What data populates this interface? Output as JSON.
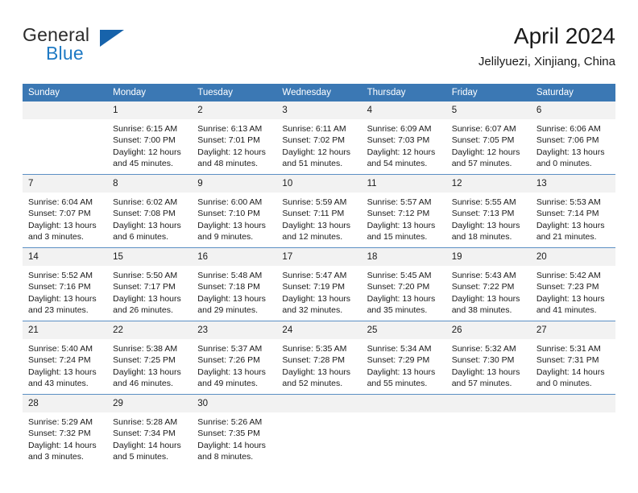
{
  "brand": {
    "name_top": "General",
    "name_bottom": "Blue",
    "triangle_color": "#1763ab",
    "blue_color": "#1f7ac4"
  },
  "header": {
    "month_title": "April 2024",
    "location": "Jelilyuezi, Xinjiang, China",
    "accent_color": "#3b78b4"
  },
  "weekday_headers": [
    "Sunday",
    "Monday",
    "Tuesday",
    "Wednesday",
    "Thursday",
    "Friday",
    "Saturday"
  ],
  "labels": {
    "sunrise": "Sunrise:",
    "sunset": "Sunset:",
    "daylight": "Daylight:"
  },
  "weeks": [
    [
      {
        "day": "",
        "sunrise": "",
        "sunset": "",
        "daylight_line1": "",
        "daylight_line2": ""
      },
      {
        "day": "1",
        "sunrise": "Sunrise: 6:15 AM",
        "sunset": "Sunset: 7:00 PM",
        "daylight_line1": "Daylight: 12 hours",
        "daylight_line2": "and 45 minutes."
      },
      {
        "day": "2",
        "sunrise": "Sunrise: 6:13 AM",
        "sunset": "Sunset: 7:01 PM",
        "daylight_line1": "Daylight: 12 hours",
        "daylight_line2": "and 48 minutes."
      },
      {
        "day": "3",
        "sunrise": "Sunrise: 6:11 AM",
        "sunset": "Sunset: 7:02 PM",
        "daylight_line1": "Daylight: 12 hours",
        "daylight_line2": "and 51 minutes."
      },
      {
        "day": "4",
        "sunrise": "Sunrise: 6:09 AM",
        "sunset": "Sunset: 7:03 PM",
        "daylight_line1": "Daylight: 12 hours",
        "daylight_line2": "and 54 minutes."
      },
      {
        "day": "5",
        "sunrise": "Sunrise: 6:07 AM",
        "sunset": "Sunset: 7:05 PM",
        "daylight_line1": "Daylight: 12 hours",
        "daylight_line2": "and 57 minutes."
      },
      {
        "day": "6",
        "sunrise": "Sunrise: 6:06 AM",
        "sunset": "Sunset: 7:06 PM",
        "daylight_line1": "Daylight: 13 hours",
        "daylight_line2": "and 0 minutes."
      }
    ],
    [
      {
        "day": "7",
        "sunrise": "Sunrise: 6:04 AM",
        "sunset": "Sunset: 7:07 PM",
        "daylight_line1": "Daylight: 13 hours",
        "daylight_line2": "and 3 minutes."
      },
      {
        "day": "8",
        "sunrise": "Sunrise: 6:02 AM",
        "sunset": "Sunset: 7:08 PM",
        "daylight_line1": "Daylight: 13 hours",
        "daylight_line2": "and 6 minutes."
      },
      {
        "day": "9",
        "sunrise": "Sunrise: 6:00 AM",
        "sunset": "Sunset: 7:10 PM",
        "daylight_line1": "Daylight: 13 hours",
        "daylight_line2": "and 9 minutes."
      },
      {
        "day": "10",
        "sunrise": "Sunrise: 5:59 AM",
        "sunset": "Sunset: 7:11 PM",
        "daylight_line1": "Daylight: 13 hours",
        "daylight_line2": "and 12 minutes."
      },
      {
        "day": "11",
        "sunrise": "Sunrise: 5:57 AM",
        "sunset": "Sunset: 7:12 PM",
        "daylight_line1": "Daylight: 13 hours",
        "daylight_line2": "and 15 minutes."
      },
      {
        "day": "12",
        "sunrise": "Sunrise: 5:55 AM",
        "sunset": "Sunset: 7:13 PM",
        "daylight_line1": "Daylight: 13 hours",
        "daylight_line2": "and 18 minutes."
      },
      {
        "day": "13",
        "sunrise": "Sunrise: 5:53 AM",
        "sunset": "Sunset: 7:14 PM",
        "daylight_line1": "Daylight: 13 hours",
        "daylight_line2": "and 21 minutes."
      }
    ],
    [
      {
        "day": "14",
        "sunrise": "Sunrise: 5:52 AM",
        "sunset": "Sunset: 7:16 PM",
        "daylight_line1": "Daylight: 13 hours",
        "daylight_line2": "and 23 minutes."
      },
      {
        "day": "15",
        "sunrise": "Sunrise: 5:50 AM",
        "sunset": "Sunset: 7:17 PM",
        "daylight_line1": "Daylight: 13 hours",
        "daylight_line2": "and 26 minutes."
      },
      {
        "day": "16",
        "sunrise": "Sunrise: 5:48 AM",
        "sunset": "Sunset: 7:18 PM",
        "daylight_line1": "Daylight: 13 hours",
        "daylight_line2": "and 29 minutes."
      },
      {
        "day": "17",
        "sunrise": "Sunrise: 5:47 AM",
        "sunset": "Sunset: 7:19 PM",
        "daylight_line1": "Daylight: 13 hours",
        "daylight_line2": "and 32 minutes."
      },
      {
        "day": "18",
        "sunrise": "Sunrise: 5:45 AM",
        "sunset": "Sunset: 7:20 PM",
        "daylight_line1": "Daylight: 13 hours",
        "daylight_line2": "and 35 minutes."
      },
      {
        "day": "19",
        "sunrise": "Sunrise: 5:43 AM",
        "sunset": "Sunset: 7:22 PM",
        "daylight_line1": "Daylight: 13 hours",
        "daylight_line2": "and 38 minutes."
      },
      {
        "day": "20",
        "sunrise": "Sunrise: 5:42 AM",
        "sunset": "Sunset: 7:23 PM",
        "daylight_line1": "Daylight: 13 hours",
        "daylight_line2": "and 41 minutes."
      }
    ],
    [
      {
        "day": "21",
        "sunrise": "Sunrise: 5:40 AM",
        "sunset": "Sunset: 7:24 PM",
        "daylight_line1": "Daylight: 13 hours",
        "daylight_line2": "and 43 minutes."
      },
      {
        "day": "22",
        "sunrise": "Sunrise: 5:38 AM",
        "sunset": "Sunset: 7:25 PM",
        "daylight_line1": "Daylight: 13 hours",
        "daylight_line2": "and 46 minutes."
      },
      {
        "day": "23",
        "sunrise": "Sunrise: 5:37 AM",
        "sunset": "Sunset: 7:26 PM",
        "daylight_line1": "Daylight: 13 hours",
        "daylight_line2": "and 49 minutes."
      },
      {
        "day": "24",
        "sunrise": "Sunrise: 5:35 AM",
        "sunset": "Sunset: 7:28 PM",
        "daylight_line1": "Daylight: 13 hours",
        "daylight_line2": "and 52 minutes."
      },
      {
        "day": "25",
        "sunrise": "Sunrise: 5:34 AM",
        "sunset": "Sunset: 7:29 PM",
        "daylight_line1": "Daylight: 13 hours",
        "daylight_line2": "and 55 minutes."
      },
      {
        "day": "26",
        "sunrise": "Sunrise: 5:32 AM",
        "sunset": "Sunset: 7:30 PM",
        "daylight_line1": "Daylight: 13 hours",
        "daylight_line2": "and 57 minutes."
      },
      {
        "day": "27",
        "sunrise": "Sunrise: 5:31 AM",
        "sunset": "Sunset: 7:31 PM",
        "daylight_line1": "Daylight: 14 hours",
        "daylight_line2": "and 0 minutes."
      }
    ],
    [
      {
        "day": "28",
        "sunrise": "Sunrise: 5:29 AM",
        "sunset": "Sunset: 7:32 PM",
        "daylight_line1": "Daylight: 14 hours",
        "daylight_line2": "and 3 minutes."
      },
      {
        "day": "29",
        "sunrise": "Sunrise: 5:28 AM",
        "sunset": "Sunset: 7:34 PM",
        "daylight_line1": "Daylight: 14 hours",
        "daylight_line2": "and 5 minutes."
      },
      {
        "day": "30",
        "sunrise": "Sunrise: 5:26 AM",
        "sunset": "Sunset: 7:35 PM",
        "daylight_line1": "Daylight: 14 hours",
        "daylight_line2": "and 8 minutes."
      },
      {
        "day": "",
        "sunrise": "",
        "sunset": "",
        "daylight_line1": "",
        "daylight_line2": ""
      },
      {
        "day": "",
        "sunrise": "",
        "sunset": "",
        "daylight_line1": "",
        "daylight_line2": ""
      },
      {
        "day": "",
        "sunrise": "",
        "sunset": "",
        "daylight_line1": "",
        "daylight_line2": ""
      },
      {
        "day": "",
        "sunrise": "",
        "sunset": "",
        "daylight_line1": "",
        "daylight_line2": ""
      }
    ]
  ]
}
